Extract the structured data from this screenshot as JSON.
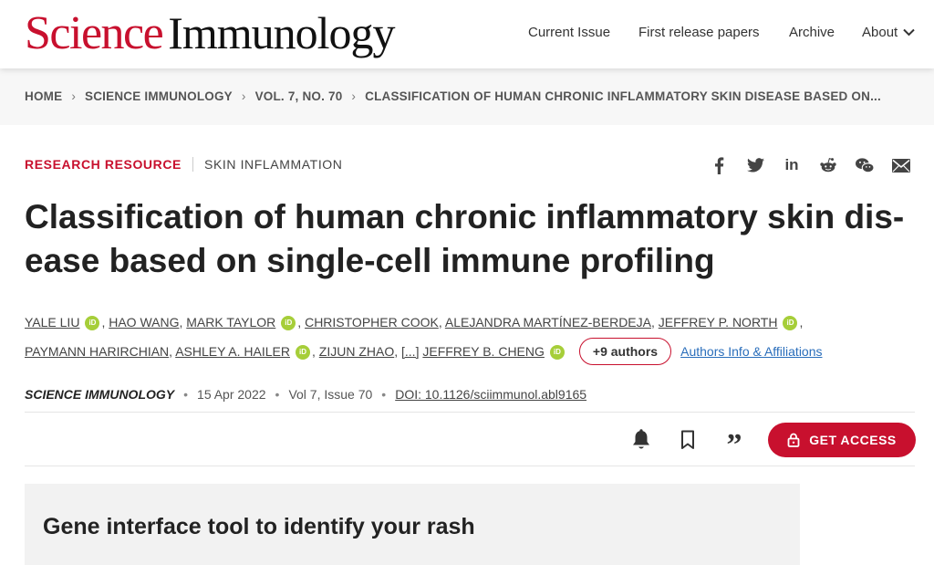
{
  "brand": {
    "science": "Science",
    "journal": "Immunology"
  },
  "nav": {
    "current_issue": "Current Issue",
    "first_release": "First release papers",
    "archive": "Archive",
    "about": "About"
  },
  "breadcrumb": {
    "items": [
      "HOME",
      "SCIENCE IMMUNOLOGY",
      "VOL. 7, NO. 70",
      "CLASSIFICATION OF HUMAN CHRONIC INFLAMMATORY SKIN DISEASE BASED ON..."
    ]
  },
  "article": {
    "type": "RESEARCH RESOURCE",
    "category": "SKIN INFLAMMATION",
    "title": "Classification of human chronic inflammatory skin dis-ease based on single-cell immune profiling",
    "authors": {
      "a1": "YALE LIU",
      "a2": "HAO WANG",
      "a3": "MARK TAYLOR",
      "a4": "CHRISTOPHER COOK",
      "a5": "ALEJANDRA MARTÍNEZ-BERDEJA",
      "a6": "JEFFREY P. NORTH",
      "a7": "PAYMANN HARIRCHIAN",
      "a8": "ASHLEY A. HAILER",
      "a9": "ZIJUN ZHAO",
      "ellipsis": "[...]",
      "a10": "JEFFREY B. CHENG",
      "orcid": "iD",
      "more": "+9 authors",
      "affiliations": "Authors Info & Affiliations"
    },
    "meta": {
      "journal": "SCIENCE IMMUNOLOGY",
      "date": "15 Apr 2022",
      "volume": "Vol 7, Issue 70",
      "doi": "DOI: 10.1126/sciimmunol.abl9165"
    },
    "get_access": "GET ACCESS",
    "teaser": "Gene interface tool to identify your rash"
  },
  "share_icons": [
    "facebook-icon",
    "twitter-icon",
    "linkedin-icon",
    "reddit-icon",
    "wechat-icon",
    "email-icon"
  ],
  "colors": {
    "accent": "#c8102e",
    "orcid": "#a6ce39",
    "link": "#2a6ebb"
  }
}
